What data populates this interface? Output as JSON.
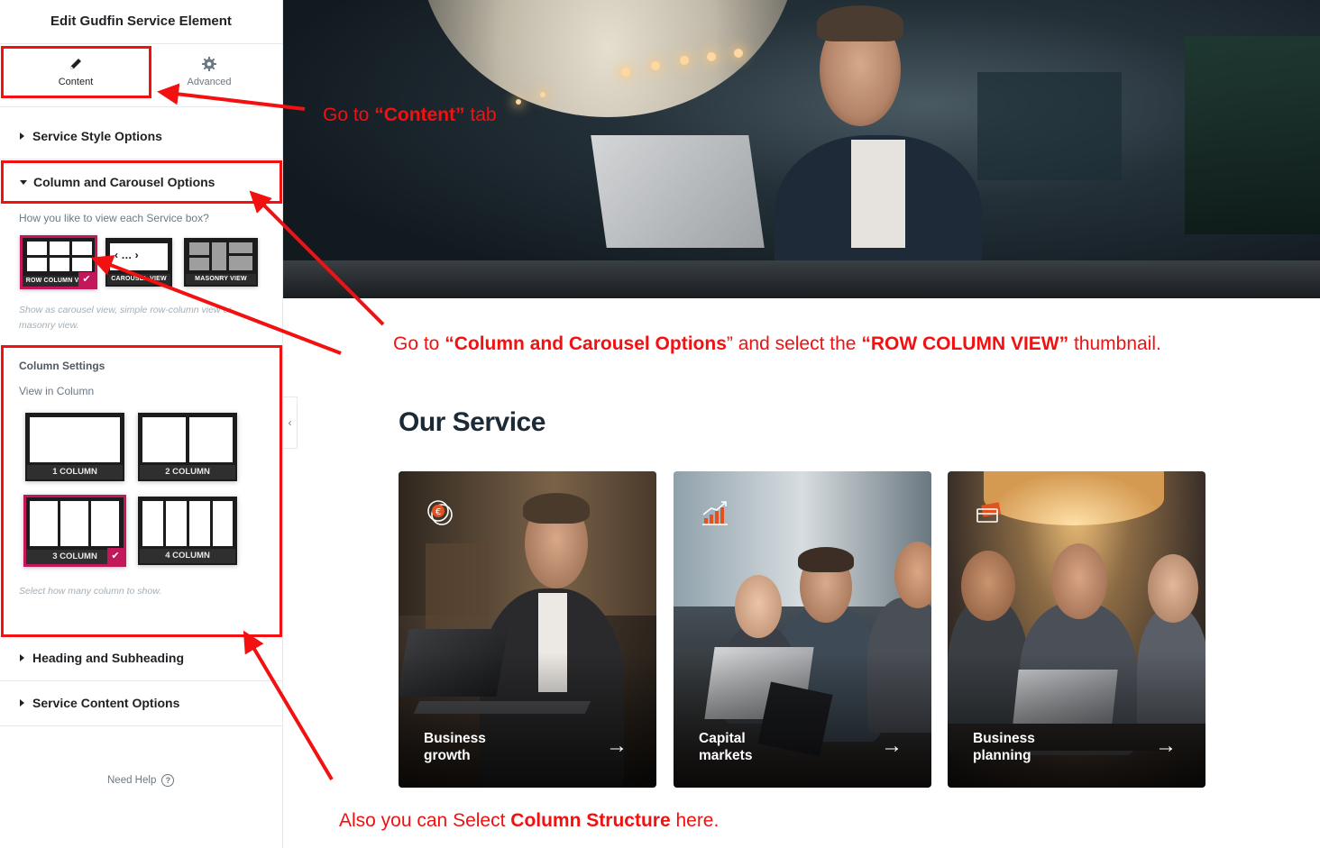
{
  "panel": {
    "title": "Edit Gudfin Service Element",
    "tabs": [
      {
        "label": "Content",
        "icon": "pencil-icon"
      },
      {
        "label": "Advanced",
        "icon": "gear-icon"
      }
    ],
    "sections": {
      "service_style": "Service Style Options",
      "column_carousel": "Column and Carousel Options",
      "heading_subheading": "Heading and Subheading",
      "service_content": "Service Content Options"
    },
    "view_question": "How you like to view each Service box?",
    "view_options": [
      "ROW COLUMN VIEW",
      "CAROUSEL VIEW",
      "MASONRY VIEW"
    ],
    "view_selected": "ROW COLUMN VIEW",
    "view_hint": "Show as carousel view, simple row-column view or masonry view.",
    "column_settings_label": "Column Settings",
    "view_in_column_label": "View in Column",
    "column_options": [
      "1 COLUMN",
      "2 COLUMN",
      "3 COLUMN",
      "4 COLUMN"
    ],
    "column_selected": "3 COLUMN",
    "column_hint": "Select how many column to show.",
    "need_help": "Need Help",
    "accent_color": "#c2185b"
  },
  "page": {
    "section_title": "Our Service",
    "cards": [
      {
        "title_line1": "Business",
        "title_line2": "growth",
        "icon": "coins-icon",
        "arrow": "→"
      },
      {
        "title_line1": "Capital",
        "title_line2": "markets",
        "icon": "chart-growth-icon",
        "arrow": "→"
      },
      {
        "title_line1": "Business",
        "title_line2": "planning",
        "icon": "card-icon",
        "arrow": "→"
      }
    ]
  },
  "annotations": {
    "color": "#f21010",
    "note1": {
      "pre": "Go  to ",
      "bold": "“Content”",
      "post": " tab"
    },
    "note2": {
      "pre": "Go to ",
      "bold1": "“Column and Carousel Options",
      "mid": "” and select the ",
      "bold2": "“ROW COLUMN VIEW”",
      "post": " thumbnail."
    },
    "note3": {
      "pre": "Also you can Select ",
      "bold": "Column Structure",
      "post": " here."
    }
  }
}
